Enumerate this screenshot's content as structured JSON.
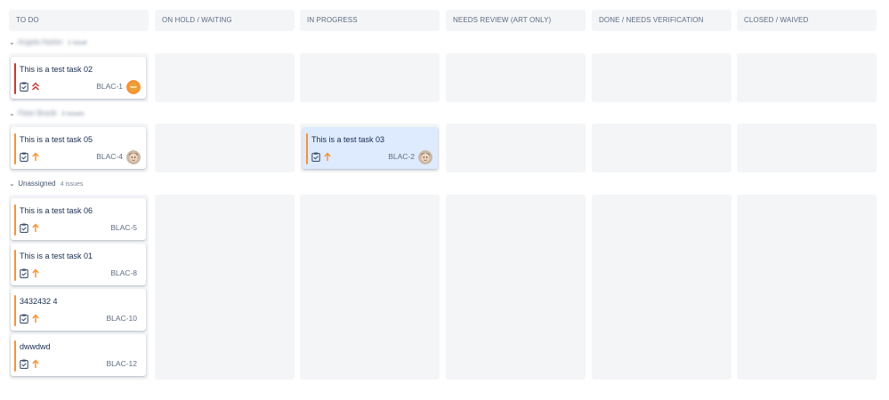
{
  "columns": [
    {
      "label": "TO DO"
    },
    {
      "label": "ON HOLD / WAITING"
    },
    {
      "label": "IN PROGRESS"
    },
    {
      "label": "NEEDS REVIEW (ART ONLY)"
    },
    {
      "label": "DONE / NEEDS VERIFICATION"
    },
    {
      "label": "CLOSED / WAIVED"
    }
  ],
  "swimlanes": [
    {
      "name": "Angela Harlen",
      "count": "1 issue"
    },
    {
      "name": "Peter Braxik",
      "count": "3 issues"
    },
    {
      "name": "Unassigned",
      "count": "4 issues"
    }
  ],
  "cards": {
    "c1": {
      "title": "This is a test task 02",
      "key": "BLAC-1",
      "priority": "highest",
      "avatar": "orange-initials"
    },
    "c2": {
      "title": "This is a test task 05",
      "key": "BLAC-4",
      "priority": "high",
      "avatar": "photo"
    },
    "c3": {
      "title": "This is a test task 03",
      "key": "BLAC-2",
      "priority": "high",
      "avatar": "photo",
      "selected": true
    },
    "c4": {
      "title": "This is a test task 06",
      "key": "BLAC-5",
      "priority": "high"
    },
    "c5": {
      "title": "This is a test task 01",
      "key": "BLAC-8",
      "priority": "high"
    },
    "c6": {
      "title": "3432432 4",
      "key": "BLAC-10",
      "priority": "high"
    },
    "c7": {
      "title": "dwwdwd",
      "key": "BLAC-12",
      "priority": "high"
    }
  },
  "colors": {
    "highest": "#c9372c",
    "high": "#f79232",
    "selected_bg": "#deebff",
    "column_bg": "#f4f5f7"
  },
  "icons": {
    "type": "task-clipboard-icon",
    "priority_highest": "double-chevron-up-icon",
    "priority_high": "arrow-up-icon",
    "lane_toggle": "chevron-down-icon"
  }
}
